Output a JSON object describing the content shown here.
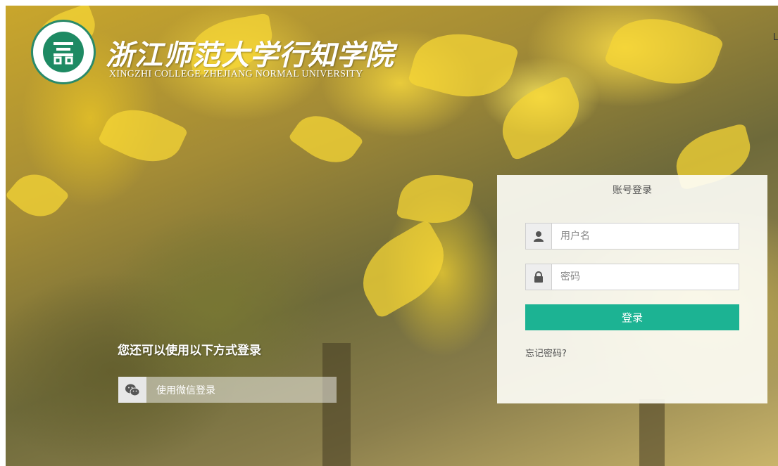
{
  "brand": {
    "title": "浙江师范大学行知学院",
    "subtitle": "XINGZHI COLLEGE ZHEJIANG NORMAL UNIVERSITY",
    "logo_icon": "college-seal-icon",
    "accent": "#1e8a63"
  },
  "edge_text": "L",
  "alt_login": {
    "title": "您还可以使用以下方式登录",
    "wechat_label": "使用微信登录",
    "wechat_icon": "wechat-icon"
  },
  "login": {
    "title": "账号登录",
    "username_placeholder": "用户名",
    "password_placeholder": "密码",
    "username_icon": "user-icon",
    "password_icon": "lock-icon",
    "submit_label": "登录",
    "submit_color": "#1cb393",
    "forgot_label": "忘记密码?"
  }
}
